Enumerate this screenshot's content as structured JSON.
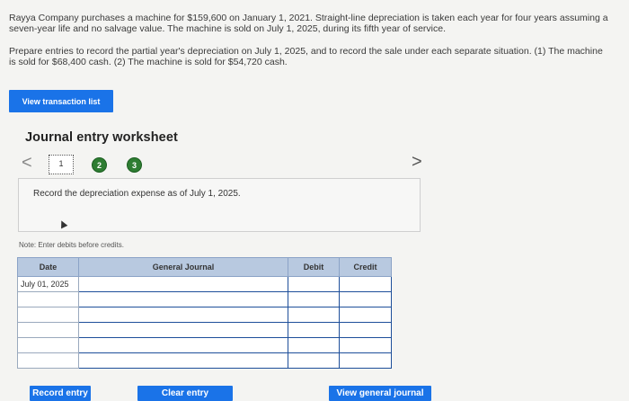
{
  "problem": {
    "paragraph1": "Rayya Company purchases a machine for $159,600 on January 1, 2021. Straight-line depreciation is taken each year for four years assuming a seven-year life and no salvage value. The machine is sold on July 1, 2025, during its fifth year of service.",
    "paragraph2": "Prepare entries to record the partial year's depreciation on July 1, 2025, and to record the sale under each separate situation. (1) The machine is sold for $68,400 cash. (2) The machine is sold for $54,720 cash."
  },
  "buttons": {
    "view_transaction_list": "View transaction list",
    "record_entry": "Record entry",
    "clear_entry": "Clear entry",
    "view_general_journal": "View general journal"
  },
  "worksheet": {
    "title": "Journal entry worksheet",
    "prev": "<",
    "next": ">",
    "steps": [
      "1",
      "2",
      "3"
    ],
    "instruction": "Record the depreciation expense as of July 1, 2025.",
    "note": "Note: Enter debits before credits."
  },
  "table": {
    "headers": {
      "date": "Date",
      "general_journal": "General Journal",
      "debit": "Debit",
      "credit": "Credit"
    },
    "rows": [
      {
        "date": "July 01, 2025"
      },
      {
        "date": ""
      },
      {
        "date": ""
      },
      {
        "date": ""
      },
      {
        "date": ""
      },
      {
        "date": ""
      }
    ]
  }
}
